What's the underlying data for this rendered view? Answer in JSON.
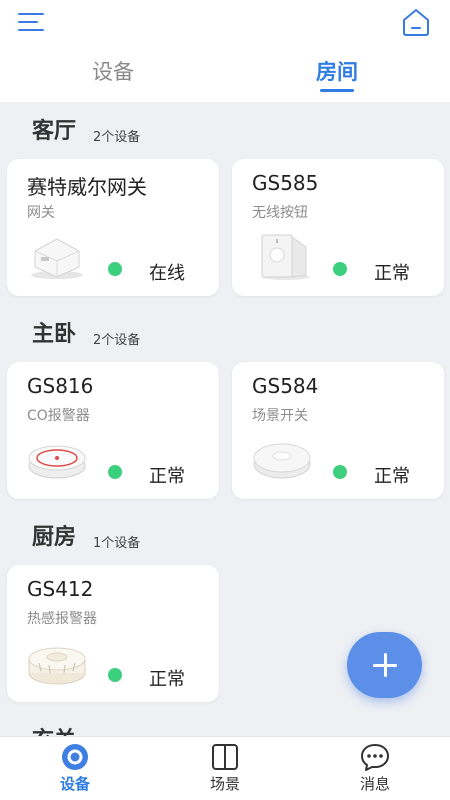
{
  "header": {
    "tabs": [
      {
        "label": "设备",
        "active": false
      },
      {
        "label": "房间",
        "active": true
      }
    ]
  },
  "rooms": [
    {
      "name": "客厅",
      "count": "2个设备",
      "devices": [
        {
          "name": "赛特威尔网关",
          "type": "网关",
          "status": "在线",
          "icon": "gateway-device-icon"
        },
        {
          "name": "GS585",
          "type": "无线按钮",
          "status": "正常",
          "icon": "wireless-button-device-icon"
        }
      ]
    },
    {
      "name": "主卧",
      "count": "2个设备",
      "devices": [
        {
          "name": "GS816",
          "type": "CO报警器",
          "status": "正常",
          "icon": "co-alarm-device-icon"
        },
        {
          "name": "GS584",
          "type": "场景开关",
          "status": "正常",
          "icon": "scene-switch-device-icon"
        }
      ]
    },
    {
      "name": "厨房",
      "count": "1个设备",
      "devices": [
        {
          "name": "GS412",
          "type": "热感报警器",
          "status": "正常",
          "icon": "heat-alarm-device-icon"
        }
      ]
    },
    {
      "name": "玄关",
      "count": "",
      "devices": []
    }
  ],
  "bottom_nav": [
    {
      "label": "设备",
      "icon": "device-tab-icon",
      "active": true
    },
    {
      "label": "场景",
      "icon": "scene-tab-icon",
      "active": false
    },
    {
      "label": "消息",
      "icon": "message-tab-icon",
      "active": false
    }
  ],
  "colors": {
    "accent": "#2f7de1",
    "status_ok": "#3ccf7e",
    "fab": "#5b8fe8",
    "background": "#eef0f4"
  }
}
